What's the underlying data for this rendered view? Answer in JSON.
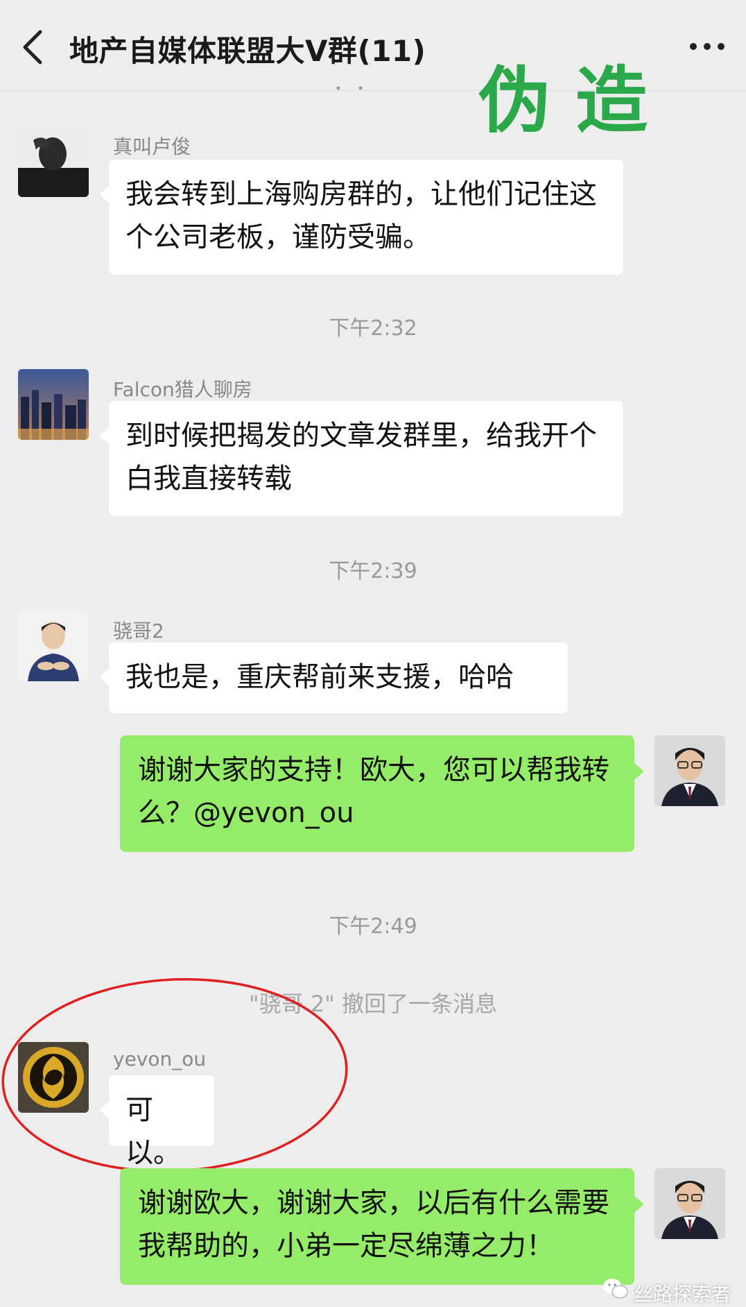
{
  "header": {
    "title": "地产自媒体联盟大V群(11)"
  },
  "overlay": {
    "stamp": "伪造"
  },
  "messages": [
    {
      "sender": "真叫卢俊",
      "text": "我会转到上海购房群的，让他们记住这个公司老板，谨防受骗。"
    },
    {
      "sender": "Falcon猎人聊房",
      "text": "到时候把揭发的文章发群里，给我开个白我直接转载"
    },
    {
      "sender": "骁哥2",
      "text": "我也是，重庆帮前来支援，哈哈"
    },
    {
      "sender": "",
      "text": "谢谢大家的支持！欧大，您可以帮我转么？@yevon_ou"
    },
    {
      "sender": "yevon_ou",
      "text": "可以。"
    },
    {
      "sender": "",
      "text": "谢谢欧大，谢谢大家，以后有什么需要我帮助的，小弟一定尽绵薄之力！"
    }
  ],
  "times": [
    "下午2:32",
    "下午2:39",
    "下午2:49"
  ],
  "notice": "\"骁哥 2\" 撤回了一条消息",
  "watermark": "丝路探索者",
  "colors": {
    "background": "#ededed",
    "bubble_self": "#95ec69",
    "bubble_other": "#ffffff",
    "stamp": "#2aa84a",
    "circle": "#e02020"
  }
}
